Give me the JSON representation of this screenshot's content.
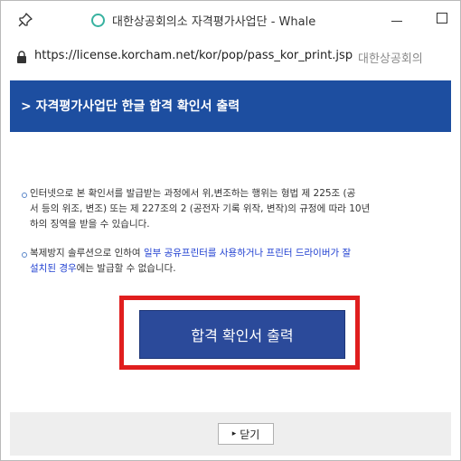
{
  "window": {
    "title": "대한상공회의소 자격평가사업단 - Whale",
    "url": "https://license.korcham.net/kor/pop/pass_kor_print.jsp",
    "site_name": "대한상공회의"
  },
  "header": {
    "title": "> 자격평가사업단 한글 합격 확인서 출력"
  },
  "notices": [
    {
      "lines": [
        "인터넷으로 본 확인서를 발급받는 과정에서 위,변조하는 행위는 형법 제 225조 (공",
        "서 등의 위조, 변조) 또는 제 227조의 2 (공전자 기록 위작, 변작)의 규정에 따라 10년",
        "하의 징역을 받을 수 있습니다."
      ]
    },
    {
      "line1_a": "복제방지 솔루션으로 인하여 ",
      "line1_b": "일부 공유프린터를 사용하거나 프린터 드라이버가 잘",
      "line2_a": "설치된 경우",
      "line2_b": "에는 발급할 수 없습니다."
    }
  ],
  "print_button": {
    "label": "합격 확인서 출력"
  },
  "close_button": {
    "label": "닫기"
  },
  "colors": {
    "header_bg": "#1d4ea0",
    "button_bg": "#2b4a9a",
    "highlight": "#e01e1e",
    "link_blue": "#1f3fd1"
  }
}
